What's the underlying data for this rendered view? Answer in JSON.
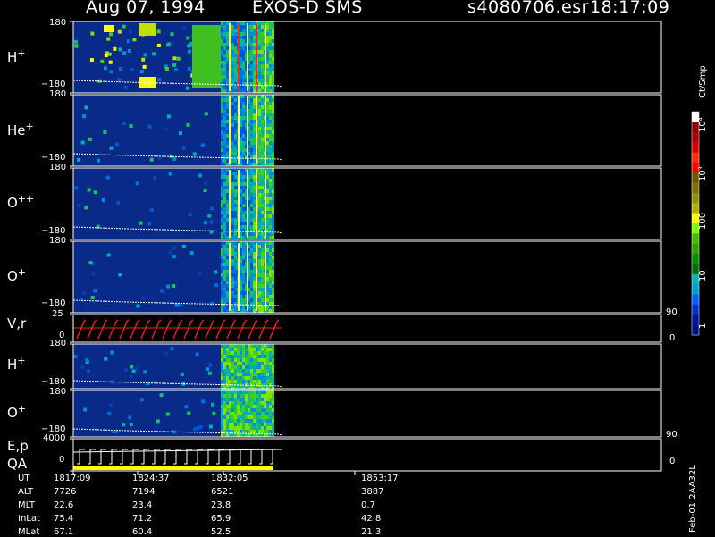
{
  "header": {
    "date": "Aug 07, 1994",
    "instrument": "EXOS-D SMS",
    "file": "s4080706.esr",
    "time": "18:17:09"
  },
  "panels": [
    {
      "id": "h1",
      "species": "H",
      "charge": "+",
      "ytop": "180",
      "ybot": "−180"
    },
    {
      "id": "he",
      "species": "He",
      "charge": "+",
      "ytop": "180",
      "ybot": "−180"
    },
    {
      "id": "opp",
      "species": "O",
      "charge": "++",
      "ytop": "180",
      "ybot": "−180"
    },
    {
      "id": "o1",
      "species": "O",
      "charge": "+",
      "ytop": "180",
      "ybot": "−180"
    },
    {
      "id": "vr",
      "label": "V,r",
      "ytop": "25",
      "ybot": "0",
      "rtop": "90",
      "rbot": "0"
    },
    {
      "id": "h2",
      "species": "H",
      "charge": "+",
      "ytop": "180",
      "ybot": "−180"
    },
    {
      "id": "o2",
      "species": "O",
      "charge": "+",
      "ytop": "180",
      "ybot": "−180"
    },
    {
      "id": "ep",
      "label1": "E,p",
      "label2": "QA",
      "ytop": "4000",
      "ybot": "0",
      "rtop": "90",
      "rbot": "0"
    }
  ],
  "colorbar": {
    "unit": "Ct/Smp",
    "labels": [
      "10⁴",
      "10³",
      "100",
      "10",
      "1"
    ],
    "colors": [
      "#ffffff",
      "#8b0000",
      "#b00000",
      "#d40000",
      "#ff2a00",
      "#ff0000",
      "#6b5a00",
      "#807000",
      "#8f8f00",
      "#b0b000",
      "#ffff00",
      "#7cfc00",
      "#3fbf00",
      "#2fa000",
      "#008f00",
      "#007000",
      "#00b3b3",
      "#00a0d0",
      "#0060ff",
      "#0030c0",
      "#0010a0",
      "#001080"
    ]
  },
  "chart_data": {
    "type": "heatmap",
    "title": "Aug 07, 1994  EXOS-D SMS  s4080706.esr  18:17:09",
    "xlabel": "UT",
    "x_ticks": [
      "1817:09",
      "1824:37",
      "1832:05",
      "1853:17"
    ],
    "ephemeris": [
      {
        "name": "UT",
        "values": [
          "1817:09",
          "1824:37",
          "1832:05",
          "1853:17"
        ]
      },
      {
        "name": "ALT",
        "values": [
          "7726",
          "7194",
          "6521",
          "3887"
        ]
      },
      {
        "name": "MLT",
        "values": [
          "22.6",
          "23.4",
          "23.8",
          "0.7"
        ]
      },
      {
        "name": "InLat",
        "values": [
          "75.4",
          "71.2",
          "65.9",
          "42.8"
        ]
      },
      {
        "name": "MLat",
        "values": [
          "67.1",
          "60.4",
          "52.5",
          "21.3"
        ]
      }
    ],
    "ylim_angle": [
      -180,
      180
    ],
    "colorbar_unit": "Ct/Smp",
    "colorbar_range": [
      1,
      10000
    ],
    "colorbar_scale": "log"
  },
  "side_label": "Feb-01 2AA32L"
}
